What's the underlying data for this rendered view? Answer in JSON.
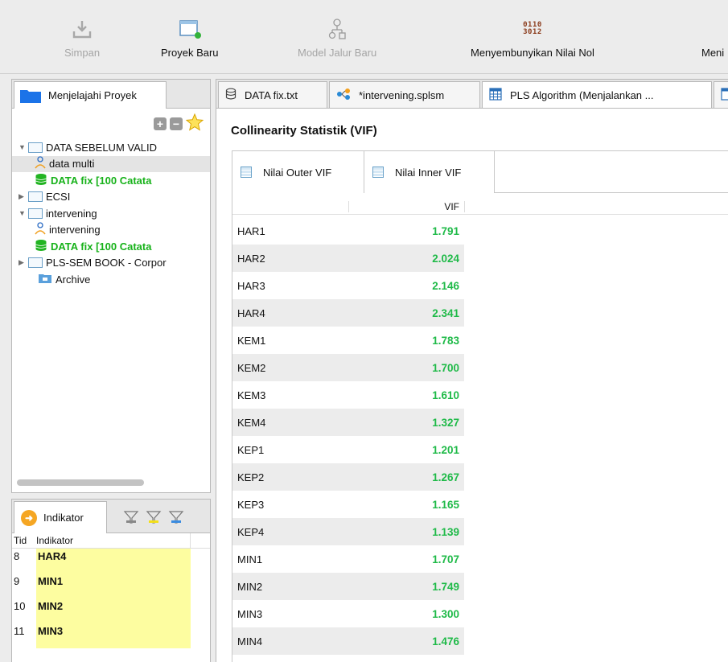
{
  "toolbar": {
    "save": "Simpan",
    "new_project": "Proyek Baru",
    "new_path_model": "Model Jalur Baru",
    "hide_zero": "Menyembunyikan Nilai Nol",
    "binary_top": "0110",
    "binary_bottom": "3012",
    "next_label": "Meni"
  },
  "explorer": {
    "tab_label": "Menjelajahi Proyek",
    "tree": [
      {
        "label": "DATA SEBELUM VALID"
      },
      {
        "label": "data multi"
      },
      {
        "label": "DATA fix [100 Catata"
      },
      {
        "label": "ECSI"
      },
      {
        "label": "intervening"
      },
      {
        "label": "intervening"
      },
      {
        "label": "DATA fix [100 Catata"
      },
      {
        "label": "PLS-SEM BOOK - Corpor"
      },
      {
        "label": "Archive"
      }
    ]
  },
  "indicators": {
    "tab_label": "Indikator",
    "col_id": "Tid",
    "col_name": "Indikator",
    "rows": [
      {
        "id": "8",
        "name": "HAR4"
      },
      {
        "id": "9",
        "name": "MIN1"
      },
      {
        "id": "10",
        "name": "MIN2"
      },
      {
        "id": "11",
        "name": "MIN3"
      }
    ]
  },
  "editor_tabs": [
    {
      "label": "DATA fix.txt"
    },
    {
      "label": "*intervening.splsm"
    },
    {
      "label": "PLS Algorithm (Menjalankan ..."
    }
  ],
  "report": {
    "title": "Collinearity Statistik (VIF)",
    "tab_outer": "Nilai Outer VIF",
    "tab_inner": "Nilai Inner VIF",
    "col_vif": "VIF",
    "rows": [
      {
        "name": "HAR1",
        "vif": "1.791"
      },
      {
        "name": "HAR2",
        "vif": "2.024"
      },
      {
        "name": "HAR3",
        "vif": "2.146"
      },
      {
        "name": "HAR4",
        "vif": "2.341"
      },
      {
        "name": "KEM1",
        "vif": "1.783"
      },
      {
        "name": "KEM2",
        "vif": "1.700"
      },
      {
        "name": "KEM3",
        "vif": "1.610"
      },
      {
        "name": "KEM4",
        "vif": "1.327"
      },
      {
        "name": "KEP1",
        "vif": "1.201"
      },
      {
        "name": "KEP2",
        "vif": "1.267"
      },
      {
        "name": "KEP3",
        "vif": "1.165"
      },
      {
        "name": "KEP4",
        "vif": "1.139"
      },
      {
        "name": "MIN1",
        "vif": "1.707"
      },
      {
        "name": "MIN2",
        "vif": "1.749"
      },
      {
        "name": "MIN3",
        "vif": "1.300"
      },
      {
        "name": "MIN4",
        "vif": "1.476"
      }
    ]
  },
  "colors": {
    "value_green": "#1fba48",
    "tree_green": "#17b21a",
    "indicator_yellow": "#fdfda0"
  }
}
